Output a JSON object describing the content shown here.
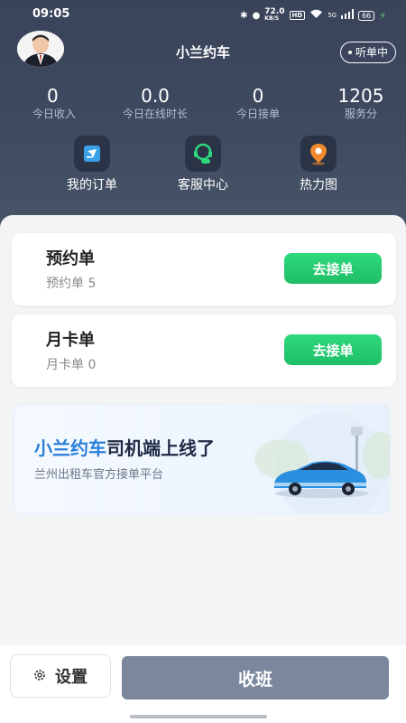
{
  "status_bar": {
    "time": "09:05",
    "net_speed": "72.0",
    "net_unit": "KB/S",
    "hd": "HD",
    "signal": "5G",
    "battery": "66"
  },
  "header": {
    "title": "小兰约车",
    "listen_status": "听单中"
  },
  "stats": [
    {
      "value": "0",
      "label": "今日收入"
    },
    {
      "value": "0.0",
      "label": "今日在线时长"
    },
    {
      "value": "0",
      "label": "今日接单"
    },
    {
      "value": "1205",
      "label": "服务分"
    }
  ],
  "menu": [
    {
      "label": "我的订单",
      "icon": "order-icon"
    },
    {
      "label": "客服中心",
      "icon": "headset-icon"
    },
    {
      "label": "热力图",
      "icon": "map-pin-icon"
    }
  ],
  "cards": [
    {
      "title": "预约单",
      "subtitle": "预约单 5",
      "button": "去接单"
    },
    {
      "title": "月卡单",
      "subtitle": "月卡单 0",
      "button": "去接单"
    }
  ],
  "banner": {
    "title_highlight": "小兰约车",
    "title_rest": "司机端上线了",
    "subtitle": "兰州出租车官方接单平台"
  },
  "footer": {
    "settings_label": "设置",
    "off_duty_label": "收班"
  },
  "colors": {
    "header_bg": "#3e4a60",
    "accent_green": "#1fbf66",
    "accent_blue": "#2a7fd9",
    "off_duty_btn": "#7a879d"
  }
}
